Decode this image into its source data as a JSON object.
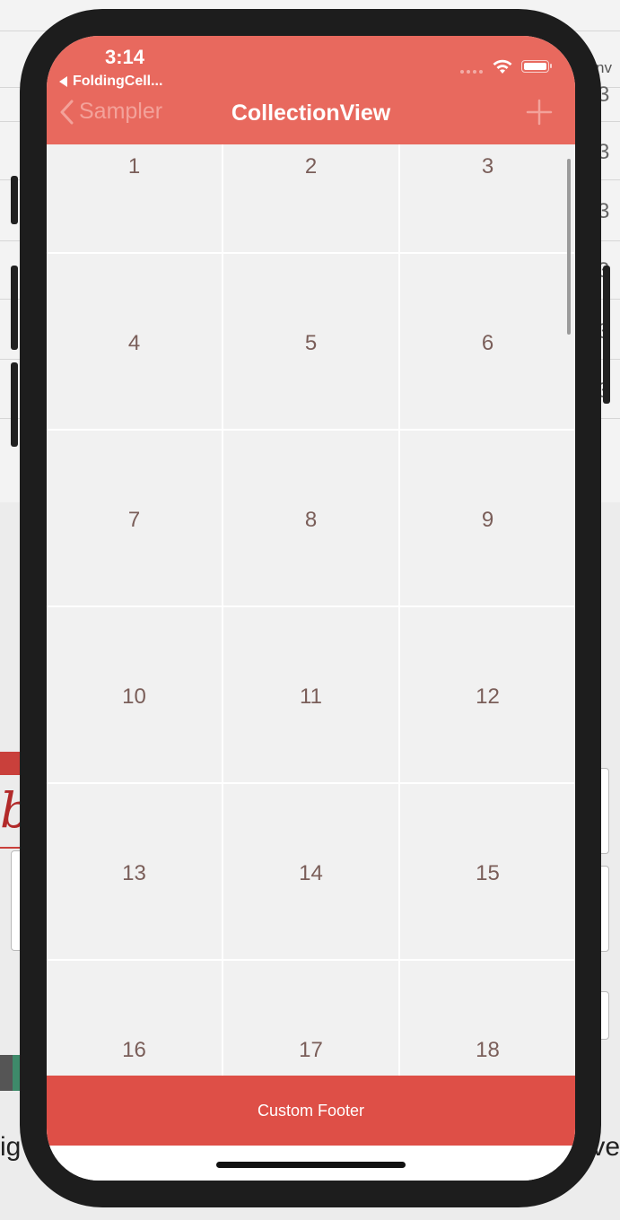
{
  "status_bar": {
    "time": "3:14",
    "back_app": "FoldingCell..."
  },
  "navbar": {
    "back_label": "Sampler",
    "title": "CollectionView",
    "add_icon": "plus-icon"
  },
  "grid": {
    "items": [
      "1",
      "2",
      "3",
      "4",
      "5",
      "6",
      "7",
      "8",
      "9",
      "10",
      "11",
      "12",
      "13",
      "14",
      "15",
      "16",
      "17",
      "18"
    ]
  },
  "footer": {
    "label": "Custom Footer"
  },
  "background": {
    "left_text": "ig",
    "right_text": "ve",
    "top_right_text": "nv"
  },
  "colors": {
    "navbar": "#e8695e",
    "footer": "#de4f47",
    "cell_bg": "#f1f1f1",
    "cell_text": "#7a5e59",
    "back_text": "#f3a29a"
  }
}
